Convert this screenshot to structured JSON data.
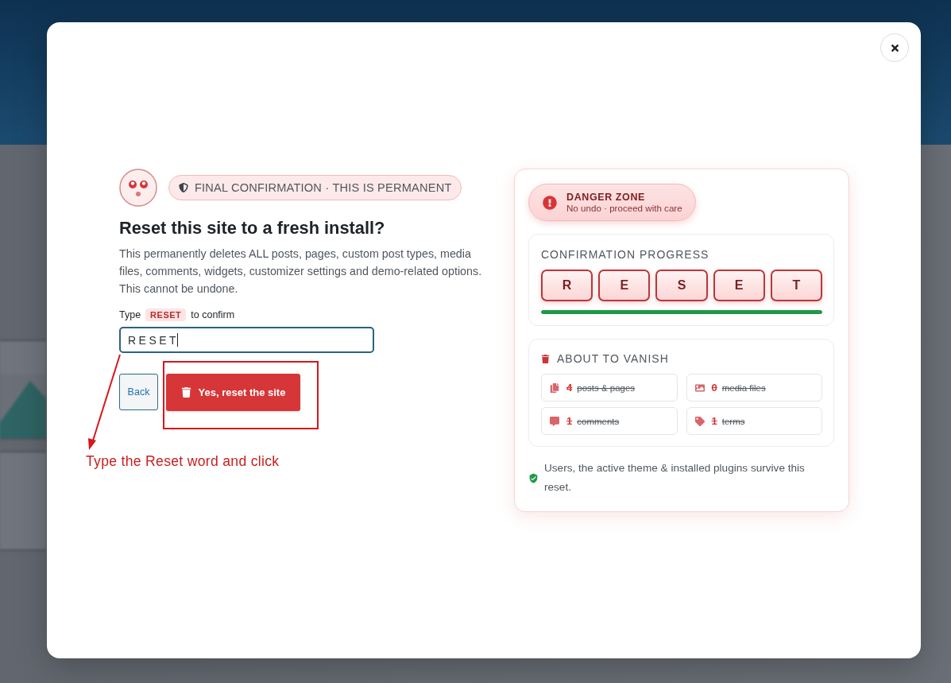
{
  "header": {
    "badge": "FINAL CONFIRMATION · THIS IS PERMANENT",
    "title": "Reset this site to a fresh install?",
    "description": "This permanently deletes ALL posts, pages, custom post types, media files, comments, widgets, customizer settings and demo-related options. This cannot be undone."
  },
  "confirm": {
    "prompt": [
      {
        "kind": "text",
        "text": "Type"
      },
      {
        "kind": "keyword",
        "text": "RESET"
      },
      {
        "kind": "text",
        "text": "to confirm"
      }
    ],
    "value": "RESET"
  },
  "buttons": [
    {
      "kind": "secondary",
      "label": "Back"
    },
    {
      "kind": "danger",
      "label": "Yes, reset the site"
    }
  ],
  "annotation": {
    "text": "Type the Reset word and click"
  },
  "danger_zone": {
    "title": "DANGER ZONE",
    "subtitle": "No undo · proceed with care"
  },
  "progress": {
    "title": "CONFIRMATION PROGRESS",
    "letters": [
      {
        "text": "R",
        "filled": true
      },
      {
        "text": "E",
        "filled": true
      },
      {
        "text": "S",
        "filled": true
      },
      {
        "text": "E",
        "filled": true
      },
      {
        "text": "T",
        "filled": true
      }
    ],
    "level": 1
  },
  "vanish": {
    "title": "ABOUT TO VANISH",
    "items": [
      {
        "kind": "posts",
        "count": "4",
        "label": "posts & pages"
      },
      {
        "kind": "media",
        "count": "0",
        "label": "media files"
      },
      {
        "kind": "comments",
        "count": "1",
        "label": "comments"
      },
      {
        "kind": "terms",
        "count": "1",
        "label": "terms"
      }
    ]
  },
  "footnote": "Users, the active theme & installed plugins survive this reset."
}
